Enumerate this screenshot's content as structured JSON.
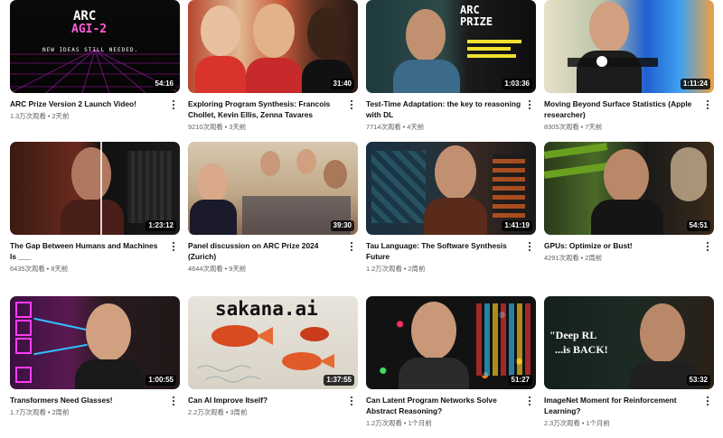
{
  "videos": [
    {
      "title": "ARC Prize Version 2 Launch Video!",
      "views": "1.3万次观看",
      "age": "2天前",
      "duration": "54:16",
      "thumb_text": [
        "ARC",
        "AGI-2",
        "NEW IDEAS STILL NEEDED."
      ]
    },
    {
      "title": "Exploring Program Synthesis: Francois Chollet, Kevin Ellis, Zenna Tavares",
      "views": "9210次观看",
      "age": "3天前",
      "duration": "31:40"
    },
    {
      "title": "Test-Time Adaptation: the key to reasoning with DL",
      "views": "7714次观看",
      "age": "4天前",
      "duration": "1:03:36",
      "thumb_text": [
        "ARC",
        "PRIZE"
      ]
    },
    {
      "title": "Moving Beyond Surface Statistics (Apple researcher)",
      "views": "8305次观看",
      "age": "7天前",
      "duration": "1:11:24"
    },
    {
      "title": "The Gap Between Humans and Machines Is ___",
      "views": "6435次观看",
      "age": "8天前",
      "duration": "1:23:12"
    },
    {
      "title": "Panel discussion on ARC Prize 2024 (Zurich)",
      "views": "4644次观看",
      "age": "9天前",
      "duration": "39:30"
    },
    {
      "title": "Tau Language: The Software Synthesis Future",
      "views": "1.2万次观看",
      "age": "2周前",
      "duration": "1:41:19"
    },
    {
      "title": "GPUs: Optimize or Bust!",
      "views": "4291次观看",
      "age": "2周前",
      "duration": "54:51"
    },
    {
      "title": "Transformers Need Glasses!",
      "views": "1.7万次观看",
      "age": "2周前",
      "duration": "1:00:55"
    },
    {
      "title": "Can AI Improve Itself?",
      "views": "2.2万次观看",
      "age": "3周前",
      "duration": "1:37:55",
      "thumb_text": [
        "sakana.ai"
      ]
    },
    {
      "title": "Can Latent Program Networks Solve Abstract Reasoning?",
      "views": "1.2万次观看",
      "age": "1个月前",
      "duration": "51:27"
    },
    {
      "title": "ImageNet Moment for Reinforcement Learning?",
      "views": "2.3万次观看",
      "age": "1个月前",
      "duration": "53:32",
      "thumb_text": [
        "\"Deep RL",
        "...is BACK!"
      ]
    }
  ],
  "icons": {
    "menu": "more-vert-icon"
  },
  "colors": {
    "title": "#0f0f0f",
    "meta": "#606060",
    "duration_bg": "#000000"
  }
}
